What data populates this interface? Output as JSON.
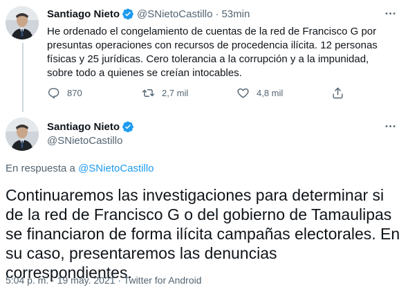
{
  "tweet": {
    "author_name": "Santiago Nieto",
    "author_handle": "@SNietoCastillo",
    "separator": "·",
    "time_ago": "53min",
    "text": "He ordenado el congelamiento de cuentas de la red de Francisco G por presuntas operaciones con recursos de procedencia ilícita. 12 personas físicas y 25 jurídicas. Cero tolerancia a la corrupción y a la impunidad, sobre todo a quienes se creían intocables.",
    "reply_count": "870",
    "retweet_count": "2,7 mil",
    "like_count": "4,8 mil"
  },
  "reply": {
    "author_name": "Santiago Nieto",
    "author_handle": "@SNietoCastillo",
    "in_reply_prefix": "En respuesta a",
    "in_reply_handle": "@SNietoCastillo",
    "text": "Continuaremos las investigaciones para determinar si de la red de Francisco G o del gobierno de Tamaulipas se financiaron de forma ilícita campañas electorales. En su caso, presentaremos las denuncias correspondientes.",
    "timestamp": "5:04 p. m. · 19 may. 2021 · Twitter for Android"
  },
  "colors": {
    "accent": "#1d9bf0",
    "secondary_text": "#536471",
    "primary_text": "#0f1419"
  },
  "icons": [
    "verified-badge-icon",
    "more-options-icon",
    "reply-icon",
    "retweet-icon",
    "like-icon",
    "share-icon"
  ]
}
